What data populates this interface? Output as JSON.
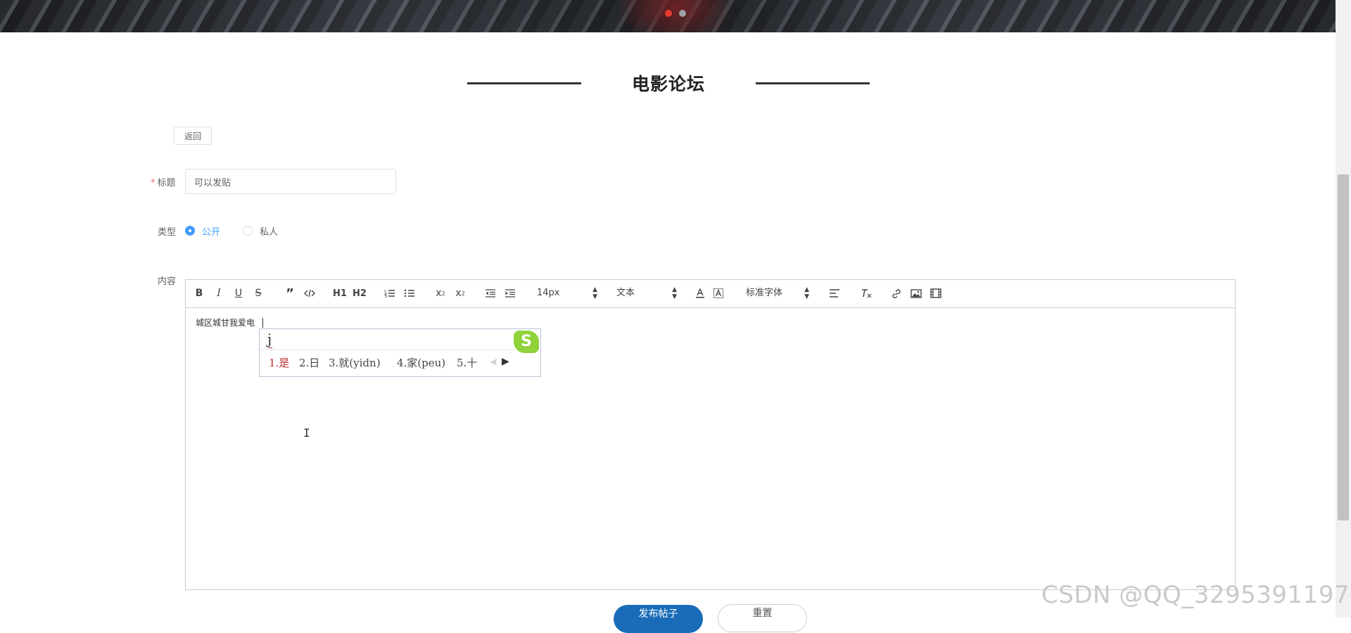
{
  "page": {
    "title": "电影论坛"
  },
  "banner": {
    "carousel_active_index": 1,
    "carousel_count": 2
  },
  "actions": {
    "back_label": "返回"
  },
  "form": {
    "title_label": "标题",
    "title_required_mark": "*",
    "title_value": "可以发贴",
    "type_label": "类型",
    "type_options": [
      "公开",
      "私人"
    ],
    "type_selected": "公开",
    "content_label": "内容"
  },
  "editor": {
    "toolbar": {
      "font_size": "14px",
      "header_select": "文本",
      "font_family": "标准字体",
      "h1": "H1",
      "h2": "H2"
    },
    "content": "城区城甘我爱电"
  },
  "ime": {
    "input": "j",
    "candidates": [
      "1.是",
      "2.日",
      "3.就(yidn)",
      "4.家(peu)",
      "5.十"
    ],
    "logo": "S"
  },
  "buttons": {
    "submit_label": "发布帖子",
    "reset_label": "重置"
  },
  "watermark": "CSDN @QQ_3295391197",
  "colors": {
    "primary": "#409eff",
    "submit": "#1a6cb8",
    "required": "#f56c6c",
    "ime_first": "#c03030"
  }
}
